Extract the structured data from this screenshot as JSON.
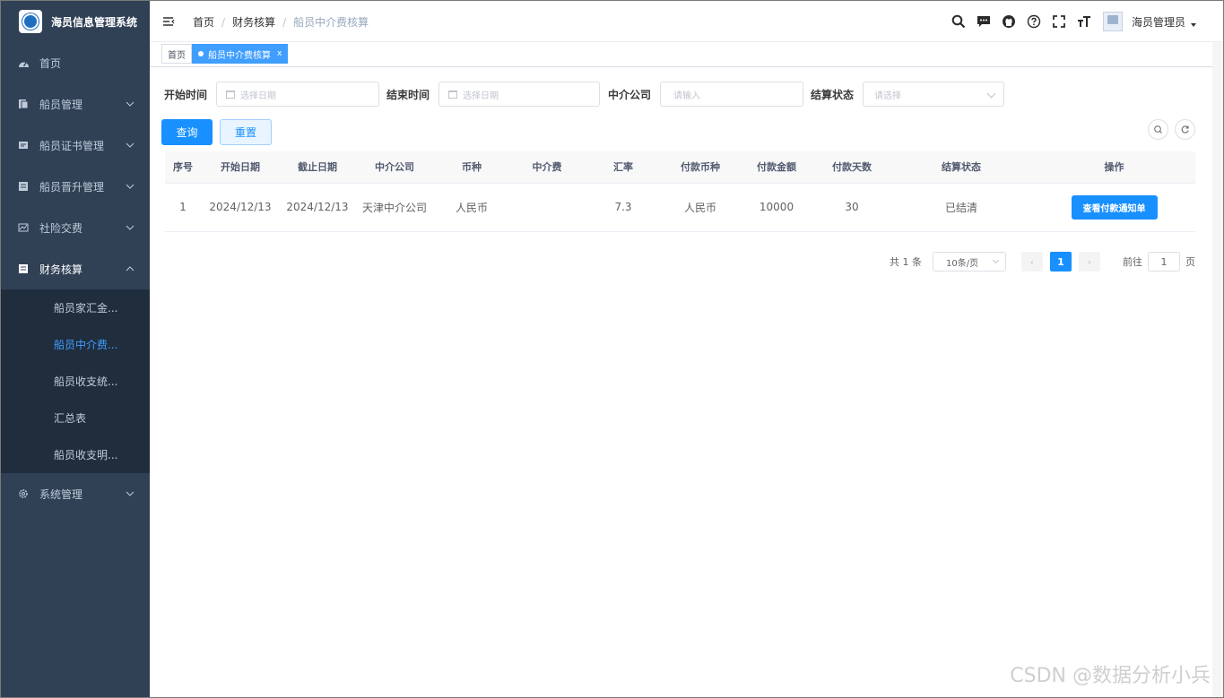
{
  "app": {
    "title": "海员信息管理系统"
  },
  "sidebar": {
    "items": [
      {
        "label": "首页",
        "icon": "dashboard-icon"
      },
      {
        "label": "船员管理",
        "icon": "document-icon"
      },
      {
        "label": "船员证书管理",
        "icon": "certificate-icon"
      },
      {
        "label": "船员晋升管理",
        "icon": "document-icon"
      },
      {
        "label": "社险交费",
        "icon": "chart-icon"
      },
      {
        "label": "财务核算",
        "icon": "document-icon"
      },
      {
        "label": "系统管理",
        "icon": "gear-icon"
      }
    ],
    "submenu": [
      "船员家汇金...",
      "船员中介费...",
      "船员收支统...",
      "汇总表",
      "船员收支明..."
    ]
  },
  "header": {
    "breadcrumb": [
      "首页",
      "财务核算",
      "船员中介费核算"
    ],
    "username": "海员管理员"
  },
  "tags": {
    "home": "首页",
    "active": "船员中介费核算",
    "close": "x"
  },
  "search": {
    "start_label": "开始时间",
    "start_placeholder": "选择日期",
    "end_label": "结束时间",
    "end_placeholder": "选择日期",
    "company_label": "中介公司",
    "company_placeholder": "请输入",
    "status_label": "结算状态",
    "status_placeholder": "请选择",
    "query_button": "查询",
    "reset_button": "重置"
  },
  "table": {
    "columns": [
      "序号",
      "开始日期",
      "截止日期",
      "中介公司",
      "币种",
      "中介费",
      "汇率",
      "付款币种",
      "付款金额",
      "付款天数",
      "结算状态",
      "操作"
    ],
    "rows": [
      [
        "1",
        "2024/12/13",
        "2024/12/13",
        "天津中介公司",
        "人民币",
        "",
        "7.3",
        "人民币",
        "10000",
        "30",
        "已结清",
        "查看付款通知单"
      ]
    ]
  },
  "pager": {
    "total": "共 1 条",
    "page_size": "10条/页",
    "current_page": "1",
    "goto_label": "前往",
    "goto_value": "1",
    "page_suffix": "页"
  },
  "watermark": "CSDN @数据分析小兵"
}
